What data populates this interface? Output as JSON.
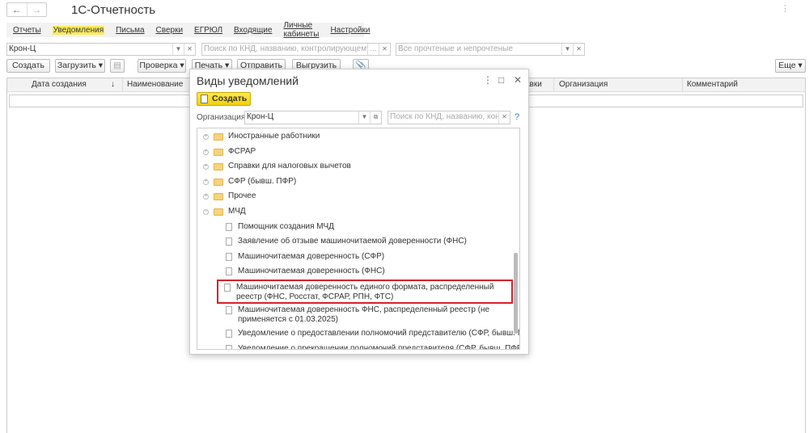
{
  "app": {
    "title": "1С-Отчетность",
    "back": "←",
    "forward": "→",
    "menu": "⋮"
  },
  "tabs": [
    {
      "label": "Отчеты"
    },
    {
      "label": "Уведомления",
      "active": true
    },
    {
      "label": "Письма"
    },
    {
      "label": "Сверки"
    },
    {
      "label": "ЕГРЮЛ"
    },
    {
      "label": "Входящие"
    },
    {
      "label": "Личные кабинеты"
    },
    {
      "label": "Настройки"
    }
  ],
  "filters": {
    "organization": "Крон-Ц",
    "search_placeholder": "Поиск по КНД, названию, контролирующему ор...",
    "read_placeholder": "Все прочтеные и непрочтеные"
  },
  "toolbar": {
    "create": "Создать",
    "load": "Загрузить",
    "check": "Проверка",
    "print": "Печать",
    "send": "Отправить",
    "export": "Выгрузить",
    "more": "Еще"
  },
  "grid": {
    "columns": [
      "Дата создания",
      "↓",
      "Наименование",
      "авки",
      "Организация",
      "Комментарий"
    ]
  },
  "dialog": {
    "title": "Виды уведомлений",
    "create": "Создать",
    "org_label": "Организация:",
    "org_value": "Крон-Ц",
    "search_placeholder": "Поиск по КНД, названию, контр...",
    "help": "?",
    "folders": [
      "Иностранные работники",
      "ФСРАР",
      "Справки для налоговых вычетов",
      "СФР (бывш. ПФР)",
      "Прочее",
      "МЧД"
    ],
    "docs": [
      "Помощник создания МЧД",
      "Заявление об отзыве машиночитаемой доверенности (ФНС)",
      "Машиночитаемая доверенность (СФР)",
      "Машиночитаемая доверенность (ФНС)",
      "Машиночитаемая доверенность единого формата, распределенный реестр (ФНС, Росстат, ФСРАР, РПН, ФТС)",
      "Машиночитаемая доверенность ФНС, распределенный реестр (не применяется с 01.03.2025)",
      "Уведомление о предоставлении полномочий представителю (СФР, бывш. ПФР)",
      "Уведомление о прекращении полномочий представителя (СФР, бывш. ПФР)"
    ],
    "highlight_color": "#d7202a"
  }
}
